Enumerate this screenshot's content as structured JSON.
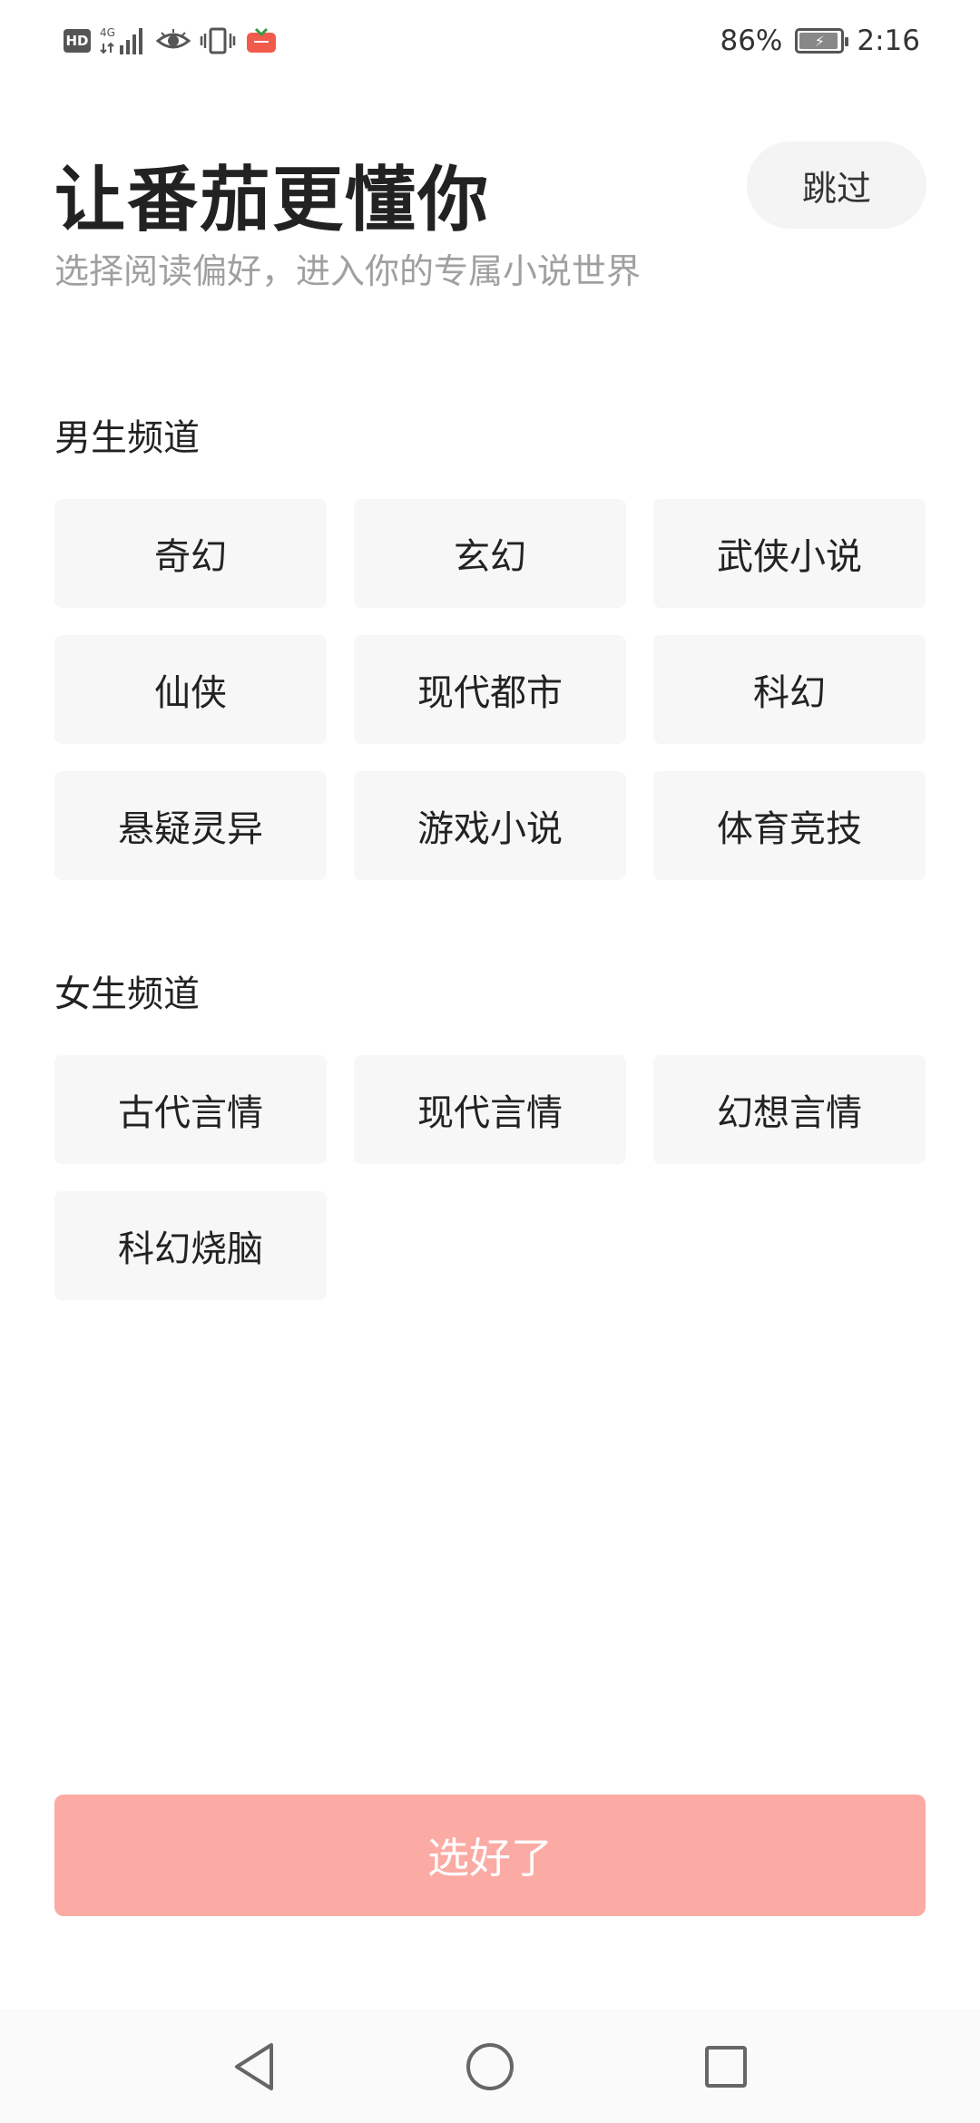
{
  "status_bar": {
    "network": "4G",
    "hd_label": "HD",
    "battery_percent": "86%",
    "battery_level": 0.86,
    "time": "2:16",
    "icons": [
      "hd-icon",
      "signal-icon",
      "eye-icon",
      "vibrate-icon",
      "tomato-app-icon",
      "battery-icon"
    ]
  },
  "header": {
    "title": "让番茄更懂你",
    "subtitle": "选择阅读偏好，进入你的专属小说世界",
    "skip_label": "跳过"
  },
  "male_channel": {
    "title": "男生频道",
    "genres": [
      "奇幻",
      "玄幻",
      "武侠小说",
      "仙侠",
      "现代都市",
      "科幻",
      "悬疑灵异",
      "游戏小说",
      "体育竞技"
    ]
  },
  "female_channel": {
    "title": "女生频道",
    "genres": [
      "古代言情",
      "现代言情",
      "幻想言情",
      "科幻烧脑"
    ]
  },
  "confirm": {
    "label": "选好了",
    "color": "#fbaaa4"
  },
  "nav_bar": {
    "icons": [
      "back-icon",
      "home-icon",
      "recents-icon"
    ]
  }
}
